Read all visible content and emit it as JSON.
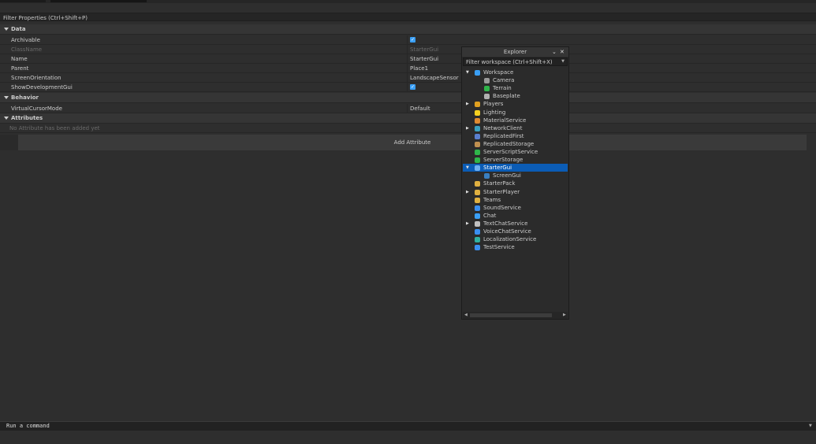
{
  "properties": {
    "filter_placeholder": "Filter Properties (Ctrl+Shift+P)",
    "sections": {
      "data": "Data",
      "behavior": "Behavior",
      "attributes": "Attributes"
    },
    "rows": [
      {
        "key": "Archivable",
        "value": "✓",
        "type": "checkbox",
        "checked": true
      },
      {
        "key": "ClassName",
        "value": "StarterGui",
        "readonly": true
      },
      {
        "key": "Name",
        "value": "StarterGui"
      },
      {
        "key": "Parent",
        "value": "Place1"
      },
      {
        "key": "ScreenOrientation",
        "value": "LandscapeSensor"
      },
      {
        "key": "ShowDevelopmentGui",
        "value": "✓",
        "type": "checkbox",
        "checked": true
      },
      {
        "key": "VirtualCursorMode",
        "value": "Default"
      }
    ],
    "no_attributes": "No Attribute has been added yet",
    "add_attribute": "Add Attribute"
  },
  "explorer": {
    "title": "Explorer",
    "filter_placeholder": "Filter workspace (Ctrl+Shift+X)",
    "items": [
      {
        "label": "Workspace",
        "depth": 0,
        "expanded": true,
        "icon": "workspace-icon",
        "color": "#3a9ff5"
      },
      {
        "label": "Camera",
        "depth": 1,
        "icon": "camera-icon",
        "color": "#9a9a9a"
      },
      {
        "label": "Terrain",
        "depth": 1,
        "icon": "terrain-icon",
        "color": "#2fb54a"
      },
      {
        "label": "Baseplate",
        "depth": 1,
        "icon": "part-icon",
        "color": "#b0b0b0"
      },
      {
        "label": "Players",
        "depth": 0,
        "collapsed": true,
        "icon": "players-icon",
        "color": "#e0a020"
      },
      {
        "label": "Lighting",
        "depth": 0,
        "icon": "lighting-icon",
        "color": "#f5d020"
      },
      {
        "label": "MaterialService",
        "depth": 0,
        "icon": "material-service-icon",
        "color": "#e08a30"
      },
      {
        "label": "NetworkClient",
        "depth": 0,
        "collapsed": true,
        "icon": "network-client-icon",
        "color": "#3aa0c0"
      },
      {
        "label": "ReplicatedFirst",
        "depth": 0,
        "icon": "replicated-first-icon",
        "color": "#5a7fcf"
      },
      {
        "label": "ReplicatedStorage",
        "depth": 0,
        "icon": "replicated-storage-icon",
        "color": "#c09050"
      },
      {
        "label": "ServerScriptService",
        "depth": 0,
        "icon": "server-script-service-icon",
        "color": "#2fb54a"
      },
      {
        "label": "ServerStorage",
        "depth": 0,
        "icon": "server-storage-icon",
        "color": "#2fb54a"
      },
      {
        "label": "StarterGui",
        "depth": 0,
        "expanded": true,
        "selected": true,
        "icon": "starter-gui-icon",
        "color": "#6fb0f0"
      },
      {
        "label": "ScreenGui",
        "depth": 1,
        "icon": "screen-gui-icon",
        "color": "#3a7fc0"
      },
      {
        "label": "StarterPack",
        "depth": 0,
        "icon": "starter-pack-icon",
        "color": "#e0b040"
      },
      {
        "label": "StarterPlayer",
        "depth": 0,
        "collapsed": true,
        "icon": "starter-player-icon",
        "color": "#e0b040"
      },
      {
        "label": "Teams",
        "depth": 0,
        "icon": "teams-icon",
        "color": "#e0b040"
      },
      {
        "label": "SoundService",
        "depth": 0,
        "icon": "sound-service-icon",
        "color": "#3a8ff0"
      },
      {
        "label": "Chat",
        "depth": 0,
        "icon": "chat-icon",
        "color": "#3a9ff5"
      },
      {
        "label": "TextChatService",
        "depth": 0,
        "collapsed": true,
        "icon": "text-chat-service-icon",
        "color": "#c0c0c0"
      },
      {
        "label": "VoiceChatService",
        "depth": 0,
        "icon": "voice-chat-service-icon",
        "color": "#3a8ff0"
      },
      {
        "label": "LocalizationService",
        "depth": 0,
        "icon": "localization-service-icon",
        "color": "#30b0a0"
      },
      {
        "label": "TestService",
        "depth": 0,
        "icon": "test-service-icon",
        "color": "#3a8ff0"
      }
    ]
  },
  "command_bar": {
    "placeholder": "Run a command"
  }
}
